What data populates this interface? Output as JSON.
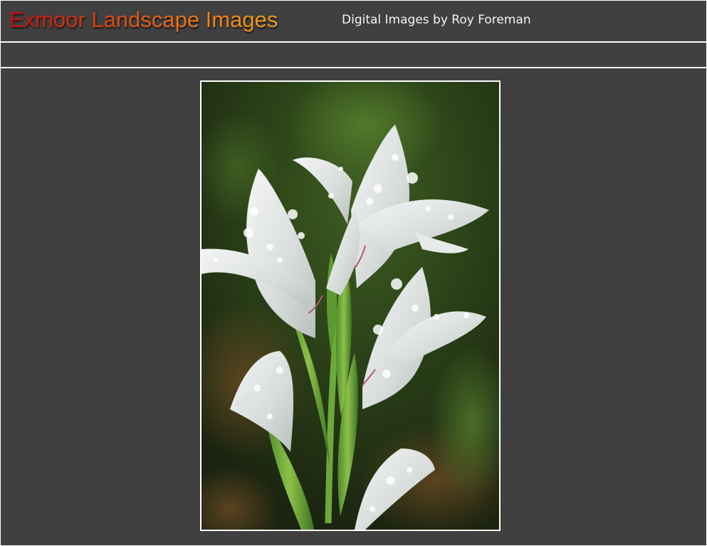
{
  "header": {
    "title": "Exmoor Landscape Images",
    "subtitle": "Digital Images by Roy Foreman"
  },
  "colors": {
    "background": "#404040",
    "divider": "#ffffff",
    "title_gradient_start": "#c90d0d",
    "title_gradient_end": "#f0a01f",
    "subtitle_text": "#f4f4f4",
    "photo_border": "#ffffff"
  },
  "main": {
    "photo_icon": "flower-photo-icon"
  }
}
